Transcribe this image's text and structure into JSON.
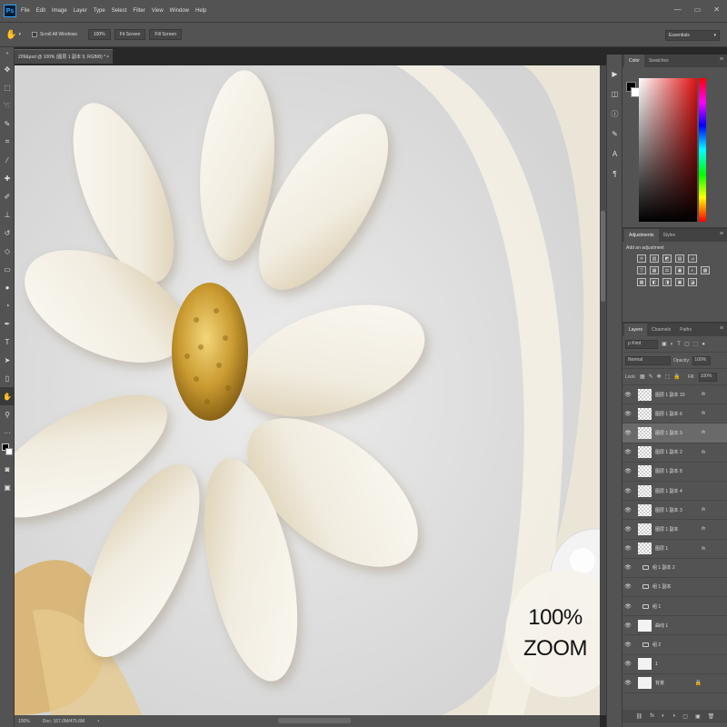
{
  "app": {
    "logo": "Ps"
  },
  "menu": [
    "File",
    "Edit",
    "Image",
    "Layer",
    "Type",
    "Select",
    "Filter",
    "View",
    "Window",
    "Help"
  ],
  "window_controls": [
    "—",
    "▭",
    "✕"
  ],
  "options_bar": {
    "scroll_all_label": "Scroll All Windows",
    "buttons": [
      "100%",
      "Fit Screen",
      "Fill Screen"
    ],
    "workspace": "Essentials"
  },
  "document": {
    "tab_title": "209&psd @ 100% (图层 1 副本 9, RGB/8) *",
    "tab_close": "×",
    "status_zoom": "100%",
    "status_doc": "Doc: 167.0M/475.6M"
  },
  "overlay": {
    "zoom_line1": "100%",
    "zoom_line2": "ZOOM"
  },
  "colors": {
    "accent": "#31a8ff",
    "panel": "#535353",
    "dark": "#282828"
  },
  "panels": {
    "color_tabs": [
      "Color",
      "Swatches"
    ],
    "adjust_tabs": [
      "Adjustments",
      "Styles"
    ],
    "adjust_hint": "Add an adjustment",
    "adjust_icons": [
      "☀",
      "▥",
      "◩",
      "▤",
      "⊿",
      "▽",
      "▦",
      "⚖",
      "▣",
      "◐",
      "▩",
      "▦",
      "◧",
      "◨",
      "▣",
      "◪",
      "▧"
    ],
    "layers_tabs": [
      "Layers",
      "Channels",
      "Paths"
    ],
    "kind_label": "ρ Kind",
    "blend_mode": "Normal",
    "opacity_label": "Opacity:",
    "opacity_value": "100%",
    "lock_label": "Lock:",
    "fill_label": "Fill:",
    "fill_value": "100%"
  },
  "layers": [
    {
      "name": "图层 1 副本 10",
      "type": "pixel",
      "fx": true
    },
    {
      "name": "图层 1 副本 6",
      "type": "pixel",
      "fx": true
    },
    {
      "name": "图层 1 副本 9",
      "type": "pixel",
      "fx": true,
      "selected": true
    },
    {
      "name": "图层 1 副本 2",
      "type": "pixel",
      "fx": true
    },
    {
      "name": "图层 1 副本 8",
      "type": "pixel",
      "fx": false
    },
    {
      "name": "图层 1 副本 4",
      "type": "pixel",
      "fx": false
    },
    {
      "name": "图层 1 副本 3",
      "type": "pixel",
      "fx": true
    },
    {
      "name": "图层 1 副本",
      "type": "pixel",
      "fx": true
    },
    {
      "name": "图层 1",
      "type": "pixel",
      "fx": true
    },
    {
      "name": "组 1 副本 2",
      "type": "group",
      "fx": false
    },
    {
      "name": "组 1 副本",
      "type": "group",
      "fx": false
    },
    {
      "name": "组 1",
      "type": "group",
      "fx": false
    },
    {
      "name": "曲线 1",
      "type": "adjust",
      "fx": false
    },
    {
      "name": "组 2",
      "type": "group",
      "fx": false
    },
    {
      "name": "1",
      "type": "plain",
      "fx": false
    },
    {
      "name": "背景",
      "type": "background",
      "fx": false,
      "locked": true
    }
  ],
  "layers_footer": [
    "⛓",
    "fx",
    "◐",
    "◑",
    "▢",
    "▣",
    "🗑"
  ]
}
